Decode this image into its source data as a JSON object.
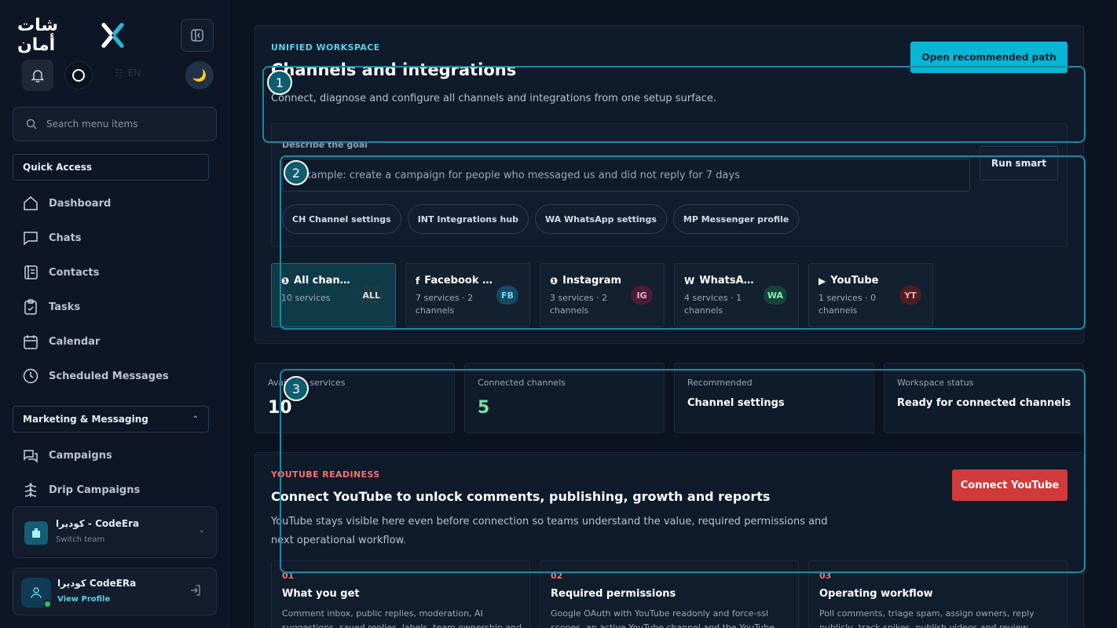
{
  "sidebar": {
    "logo_text": "شات أمان",
    "lang_label": "EN",
    "search_placeholder": "Search menu items",
    "quick_access_label": "Quick Access",
    "quick_items": [
      {
        "label": "Dashboard",
        "icon": "home-icon"
      },
      {
        "label": "Chats",
        "icon": "chat-icon"
      },
      {
        "label": "Contacts",
        "icon": "contacts-icon"
      },
      {
        "label": "Tasks",
        "icon": "tasks-icon"
      },
      {
        "label": "Calendar",
        "icon": "calendar-icon"
      },
      {
        "label": "Scheduled Messages",
        "icon": "clock-icon"
      }
    ],
    "marketing_label": "Marketing & Messaging",
    "marketing_items": [
      {
        "label": "Campaigns",
        "icon": "campaign-icon"
      },
      {
        "label": "Drip Campaigns",
        "icon": "drip-icon"
      }
    ],
    "team": {
      "name": "كوديرا - CodeEra",
      "sub": "Switch team"
    },
    "profile": {
      "name": "كوديرا CodeERa",
      "link": "View Profile"
    }
  },
  "hero": {
    "eyebrow": "UNIFIED WORKSPACE",
    "title": "Channels and integrations",
    "description": "Connect, diagnose and configure all channels and integrations from one setup surface.",
    "primary_button": "Open recommended path",
    "goal_label": "Describe the goal",
    "goal_placeholder": "Example: create a campaign for people who messaged us and did not reply for 7 days",
    "run_button": "Run smart",
    "chips": [
      "CH Channel settings",
      "INT Integrations hub",
      "WA WhatsApp settings",
      "MP Messenger profile"
    ],
    "tiles": [
      {
        "glyph": "❶",
        "name": "All chan…",
        "sub": "10 services",
        "badge": "ALL",
        "badge_bg": "#1b3a44",
        "badge_fg": "#d7e2ea",
        "active": true
      },
      {
        "glyph": "f",
        "name": "Facebook …",
        "sub": "7 services · 2 channels",
        "badge": "FB",
        "badge_bg": "#164a63",
        "badge_fg": "#7dd3fc",
        "active": false
      },
      {
        "glyph": "❶",
        "name": "Instagram",
        "sub": "3 services · 2 channels",
        "badge": "IG",
        "badge_bg": "#4a1c38",
        "badge_fg": "#f9a8d4",
        "active": false
      },
      {
        "glyph": "W",
        "name": "WhatsA…",
        "sub": "4 services · 1 channels",
        "badge": "WA",
        "badge_bg": "#13433a",
        "badge_fg": "#86efac",
        "active": false
      },
      {
        "glyph": "▶",
        "name": "YouTube",
        "sub": "1 services · 0 channels",
        "badge": "YT",
        "badge_bg": "#4a1f24",
        "badge_fg": "#fca5a5",
        "active": false
      }
    ]
  },
  "stats": [
    {
      "label": "Available services",
      "value": "10",
      "type": "number",
      "color": "#ffffff"
    },
    {
      "label": "Connected channels",
      "value": "5",
      "type": "number",
      "color": "#6ee7a0"
    },
    {
      "label": "Recommended",
      "value": "Channel settings",
      "type": "text",
      "color": "#ffffff"
    },
    {
      "label": "Workspace status",
      "value": "Ready for connected channels",
      "type": "text",
      "color": "#ffffff"
    }
  ],
  "youtube": {
    "eyebrow": "YOUTUBE READINESS",
    "title": "Connect YouTube to unlock comments, publishing, growth and reports",
    "description": "YouTube stays visible here even before connection so teams understand the value, required permissions and next operational workflow.",
    "button": "Connect YouTube",
    "cards": [
      {
        "num": "01",
        "title": "What you get",
        "text": "Comment inbox, public replies, moderation, AI suggestions, saved replies, labels, team ownership and"
      },
      {
        "num": "02",
        "title": "Required permissions",
        "text": "Google OAuth with YouTube readonly and force-ssl scopes, an active YouTube channel and the YouTube"
      },
      {
        "num": "03",
        "title": "Operating workflow",
        "text": "Poll comments, triage spam, assign owners, reply publicly, track spikes, publish videos and review"
      }
    ]
  },
  "annotations": [
    "1",
    "2",
    "3"
  ],
  "colors": {
    "accent": "#06b6d4",
    "danger": "#d03a3a",
    "success": "#6ee7a0",
    "eyebrow_hero": "#5ad1e6",
    "eyebrow_yt": "#f87171"
  }
}
